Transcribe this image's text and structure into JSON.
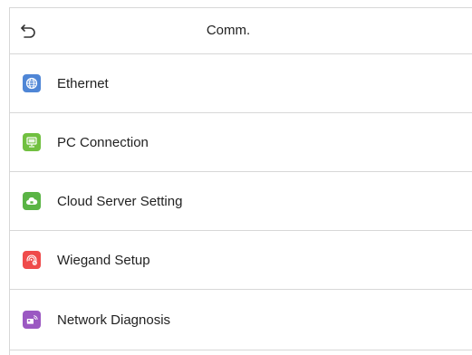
{
  "header": {
    "title": "Comm."
  },
  "menu": {
    "items": [
      {
        "label": "Ethernet",
        "icon": "globe-icon",
        "color": "#4f86d6"
      },
      {
        "label": "PC Connection",
        "icon": "computer-icon",
        "color": "#71c040"
      },
      {
        "label": "Cloud Server Setting",
        "icon": "cloud-icon",
        "color": "#5ab445"
      },
      {
        "label": "Wiegand Setup",
        "icon": "wiegand-gear-icon",
        "color": "#ef4b4b"
      },
      {
        "label": "Network Diagnosis",
        "icon": "network-diagnosis-icon",
        "color": "#9b58c2"
      }
    ]
  }
}
